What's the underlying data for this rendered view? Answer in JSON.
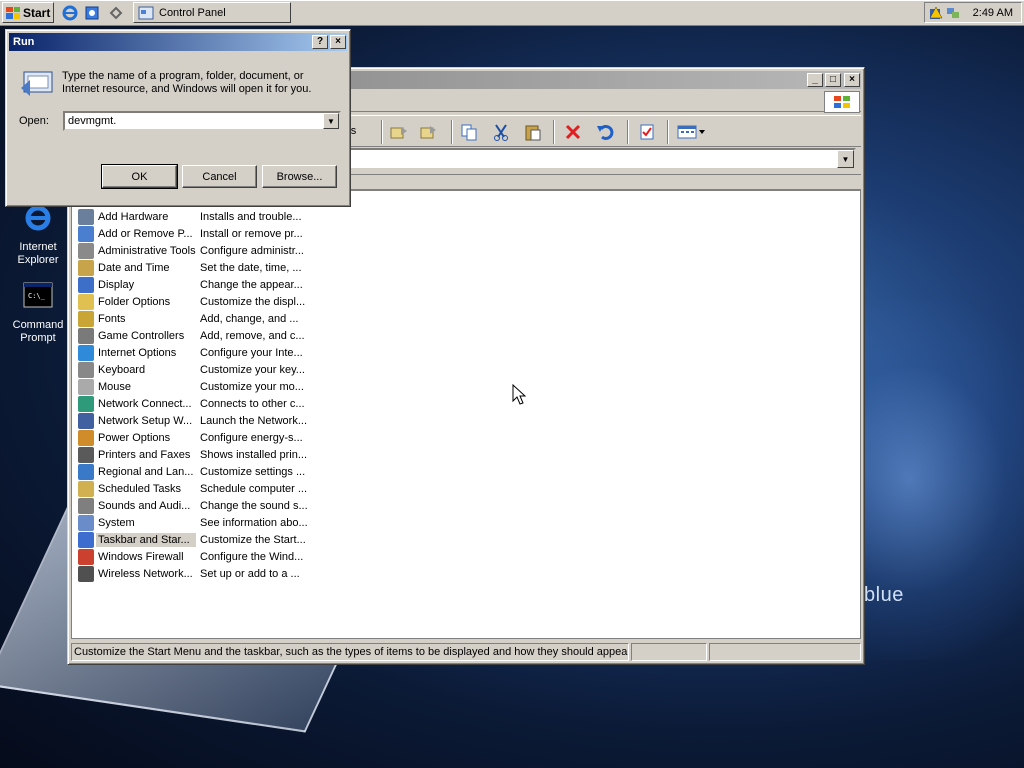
{
  "taskbar": {
    "start_label": "Start",
    "task_label": "Control Panel",
    "clock": "2:49 AM"
  },
  "desktop": {
    "icons": [
      {
        "label_line1": "Internet",
        "label_line2": "Explorer"
      },
      {
        "label_line1": "Command",
        "label_line2": "Prompt"
      }
    ],
    "brand_text": "blue"
  },
  "control_panel": {
    "toolbar_partial_label": "ers",
    "items": [
      {
        "name": "Add Hardware",
        "desc": "Installs and trouble..."
      },
      {
        "name": "Add or Remove P...",
        "desc": "Install or remove pr..."
      },
      {
        "name": "Administrative Tools",
        "desc": "Configure administr..."
      },
      {
        "name": "Date and Time",
        "desc": "Set the date, time, ..."
      },
      {
        "name": "Display",
        "desc": "Change the appear..."
      },
      {
        "name": "Folder Options",
        "desc": "Customize the displ..."
      },
      {
        "name": "Fonts",
        "desc": "Add, change, and ..."
      },
      {
        "name": "Game Controllers",
        "desc": "Add, remove, and c..."
      },
      {
        "name": "Internet Options",
        "desc": "Configure your Inte..."
      },
      {
        "name": "Keyboard",
        "desc": "Customize your key..."
      },
      {
        "name": "Mouse",
        "desc": "Customize your mo..."
      },
      {
        "name": "Network Connect...",
        "desc": "Connects to other c..."
      },
      {
        "name": "Network Setup W...",
        "desc": "Launch the Network..."
      },
      {
        "name": "Power Options",
        "desc": "Configure energy-s..."
      },
      {
        "name": "Printers and Faxes",
        "desc": "Shows installed prin..."
      },
      {
        "name": "Regional and Lan...",
        "desc": "Customize settings ..."
      },
      {
        "name": "Scheduled Tasks",
        "desc": "Schedule computer ..."
      },
      {
        "name": "Sounds and Audi...",
        "desc": "Change the sound s..."
      },
      {
        "name": "System",
        "desc": "See information abo..."
      },
      {
        "name": "Taskbar and Star...",
        "desc": "Customize the Start..."
      },
      {
        "name": "Windows Firewall",
        "desc": "Configure the Wind..."
      },
      {
        "name": "Wireless Network...",
        "desc": "Set up or add to a ..."
      }
    ],
    "selected_item": "Taskbar and Star...",
    "status_text": "Customize the Start Menu and the taskbar, such as the types of items to be displayed and how they should appear."
  },
  "run_dialog": {
    "title": "Run",
    "message": "Type the name of a program, folder, document, or Internet resource, and Windows will open it for you.",
    "open_label": "Open:",
    "open_value": "devmgmt.",
    "ok_label": "OK",
    "cancel_label": "Cancel",
    "browse_label": "Browse..."
  },
  "colors": {
    "titlebar_active": "#0a246a",
    "titlebar_inactive": "#808080",
    "face": "#d4d0c8",
    "delete_red": "#e02020"
  }
}
